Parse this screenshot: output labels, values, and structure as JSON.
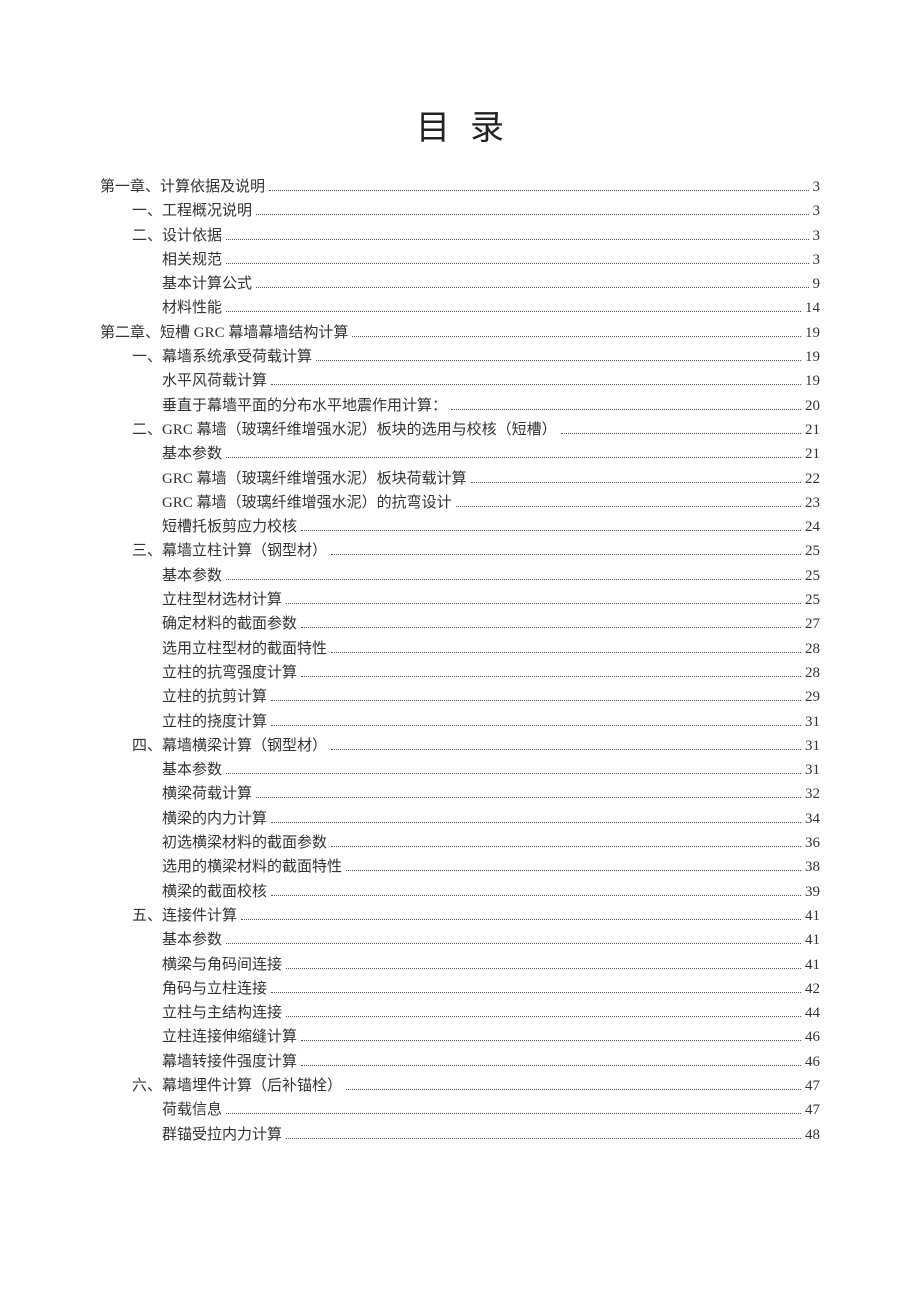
{
  "title": "目录",
  "toc": [
    {
      "indent": 0,
      "label": "第一章、计算依据及说明",
      "page": "3"
    },
    {
      "indent": 1,
      "label": "一、工程概况说明",
      "page": "3"
    },
    {
      "indent": 1,
      "label": "二、设计依据",
      "page": "3"
    },
    {
      "indent": 2,
      "label": "相关规范",
      "page": "3"
    },
    {
      "indent": 2,
      "label": "基本计算公式",
      "page": "9"
    },
    {
      "indent": 2,
      "label": "材料性能",
      "page": "14"
    },
    {
      "indent": 0,
      "label": "第二章、短槽 GRC 幕墙幕墙结构计算",
      "page": "19"
    },
    {
      "indent": 1,
      "label": "一、幕墙系统承受荷载计算",
      "page": "19"
    },
    {
      "indent": 2,
      "label": "水平风荷载计算",
      "page": "19"
    },
    {
      "indent": 2,
      "label": "垂直于幕墙平面的分布水平地震作用计算：",
      "page": "20"
    },
    {
      "indent": 1,
      "label": "二、GRC 幕墙（玻璃纤维增强水泥）板块的选用与校核（短槽）",
      "page": "21"
    },
    {
      "indent": 2,
      "label": "基本参数",
      "page": "21"
    },
    {
      "indent": 2,
      "label": "GRC 幕墙（玻璃纤维增强水泥）板块荷载计算",
      "page": "22"
    },
    {
      "indent": 2,
      "label": "GRC 幕墙（玻璃纤维增强水泥）的抗弯设计",
      "page": "23"
    },
    {
      "indent": 2,
      "label": "短槽托板剪应力校核",
      "page": "24"
    },
    {
      "indent": 1,
      "label": "三、幕墙立柱计算（钢型材）",
      "page": "25"
    },
    {
      "indent": 2,
      "label": "基本参数",
      "page": "25"
    },
    {
      "indent": 2,
      "label": "立柱型材选材计算",
      "page": "25"
    },
    {
      "indent": 2,
      "label": "确定材料的截面参数",
      "page": "27"
    },
    {
      "indent": 2,
      "label": "选用立柱型材的截面特性",
      "page": "28"
    },
    {
      "indent": 2,
      "label": "立柱的抗弯强度计算",
      "page": "28"
    },
    {
      "indent": 2,
      "label": "立柱的抗剪计算",
      "page": "29"
    },
    {
      "indent": 2,
      "label": "立柱的挠度计算",
      "page": "31"
    },
    {
      "indent": 1,
      "label": "四、幕墙横梁计算（钢型材）",
      "page": "31"
    },
    {
      "indent": 2,
      "label": "基本参数",
      "page": "31"
    },
    {
      "indent": 2,
      "label": "横梁荷载计算",
      "page": "32"
    },
    {
      "indent": 2,
      "label": "横梁的内力计算",
      "page": "34"
    },
    {
      "indent": 2,
      "label": "初选横梁材料的截面参数",
      "page": "36"
    },
    {
      "indent": 2,
      "label": "选用的横梁材料的截面特性",
      "page": "38"
    },
    {
      "indent": 2,
      "label": "横梁的截面校核",
      "page": "39"
    },
    {
      "indent": 1,
      "label": "五、连接件计算",
      "page": "41"
    },
    {
      "indent": 2,
      "label": "基本参数",
      "page": "41"
    },
    {
      "indent": 2,
      "label": "横梁与角码间连接",
      "page": "41"
    },
    {
      "indent": 2,
      "label": "角码与立柱连接",
      "page": "42"
    },
    {
      "indent": 2,
      "label": "立柱与主结构连接",
      "page": "44"
    },
    {
      "indent": 2,
      "label": "立柱连接伸缩缝计算",
      "page": "46"
    },
    {
      "indent": 2,
      "label": "幕墙转接件强度计算",
      "page": "46"
    },
    {
      "indent": 1,
      "label": "六、幕墙埋件计算（后补锚栓）",
      "page": "47"
    },
    {
      "indent": 2,
      "label": "荷载信息",
      "page": "47"
    },
    {
      "indent": 2,
      "label": "群锚受拉内力计算",
      "page": "48"
    }
  ]
}
